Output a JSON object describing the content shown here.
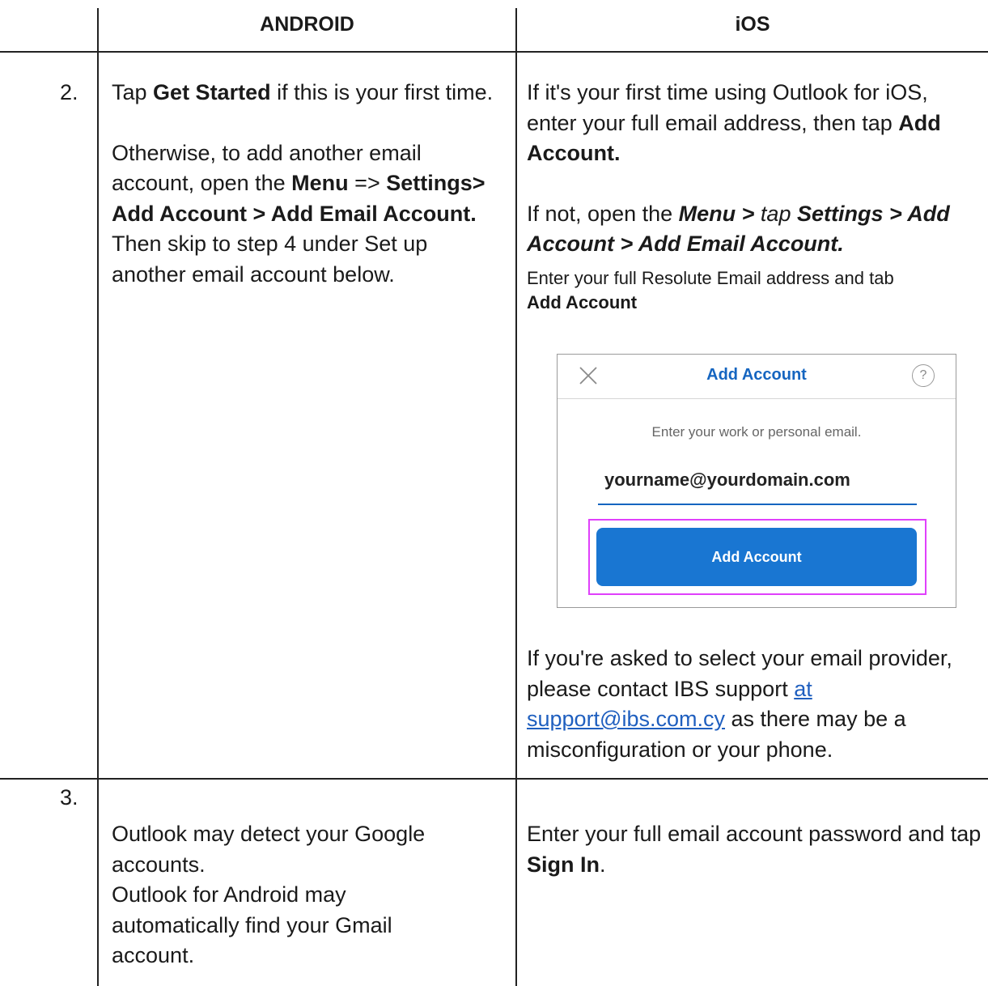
{
  "header": {
    "android": "ANDROID",
    "ios": "iOS"
  },
  "step2": {
    "number": "2.",
    "android": {
      "p1_pre": "Tap ",
      "p1_bold": "Get Started",
      "p1_post": " if this is your first time.",
      "p2_pre": "Otherwise, to add another email account, open the ",
      "p2_menu": "Menu",
      "p2_arrow": " => ",
      "p2_path": "Settings> Add Account > Add Email Account.",
      "p2_post": " Then skip to step 4 under Set up another email account below."
    },
    "ios": {
      "p1_pre": "If it's your first time using Outlook for iOS, enter your full email address, then tap ",
      "p1_bold": "Add Account.",
      "p2_pre": "If not, open the ",
      "p2_menu": "Menu > ",
      "p2_tap": "tap ",
      "p2_path": "Settings > Add Account > Add Email Account.",
      "p3_pre": "Enter your full Resolute Email address and tab ",
      "p3_bold": "Add Account",
      "p4_pre": "If you're asked to select your email provider, please contact IBS support ",
      "p4_link": "at support@ibs.com.cy",
      "p4_post": " as there may be a misconfiguration or your phone."
    },
    "screenshot": {
      "title": "Add Account",
      "help": "?",
      "prompt": "Enter your work or personal email.",
      "email_value": "yourname@yourdomain.com",
      "button_label": "Add Account"
    }
  },
  "step3": {
    "number": "3.",
    "android": {
      "p1": "Outlook may detect your Google accounts.",
      "p2": "Outlook for Android may automatically find your Gmail account."
    },
    "ios": {
      "p1_pre": "Enter your full email account password and tap ",
      "p1_bold": "Sign In",
      "p1_post": "."
    }
  },
  "colors": {
    "link": "#1f5fbf",
    "ios_accent": "#1565c0",
    "ios_button": "#1976d2",
    "highlight": "#e040fb"
  }
}
